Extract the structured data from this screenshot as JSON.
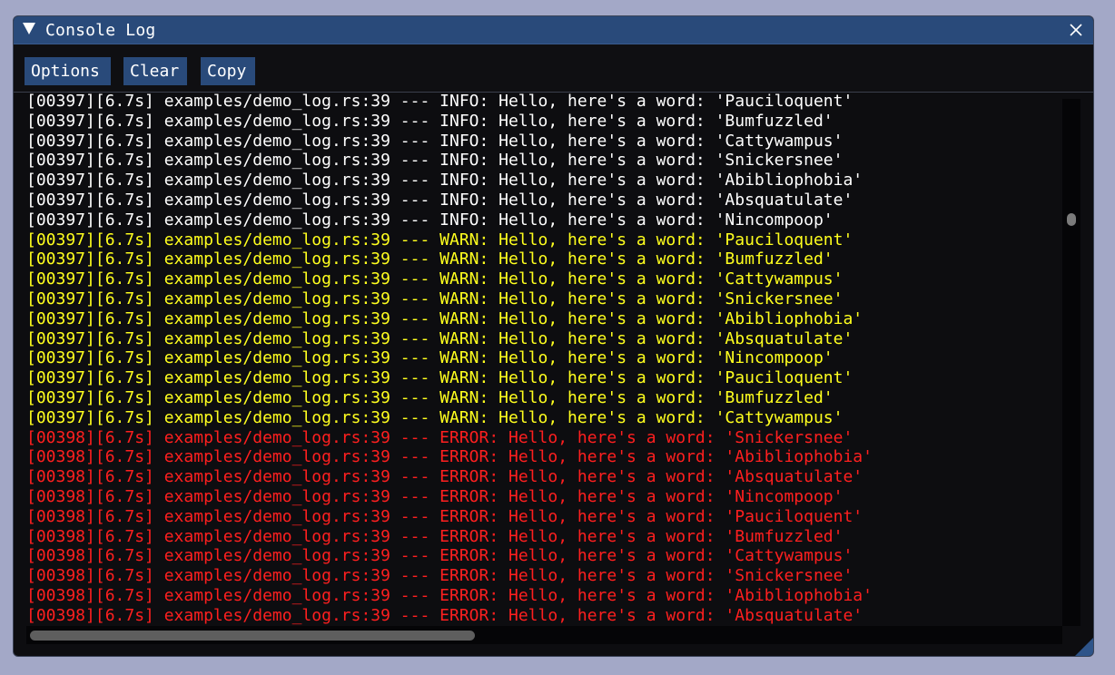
{
  "window": {
    "title": "Console Log",
    "close_glyph": "✕"
  },
  "toolbar": {
    "options_label": "Options",
    "clear_label": "Clear",
    "copy_label": "Copy"
  },
  "colors": {
    "info": "#ffffff",
    "warn": "#ffff1e",
    "error": "#ff1f1f",
    "accent": "#294a7a"
  },
  "icons": {
    "collapse": "collapse-triangle-icon",
    "close": "close-icon"
  },
  "log": [
    {
      "level": "info",
      "text": "[00397][6.7s] examples/demo_log.rs:39 --- INFO: Hello, here's a word: 'Pauciloquent'"
    },
    {
      "level": "info",
      "text": "[00397][6.7s] examples/demo_log.rs:39 --- INFO: Hello, here's a word: 'Bumfuzzled'"
    },
    {
      "level": "info",
      "text": "[00397][6.7s] examples/demo_log.rs:39 --- INFO: Hello, here's a word: 'Cattywampus'"
    },
    {
      "level": "info",
      "text": "[00397][6.7s] examples/demo_log.rs:39 --- INFO: Hello, here's a word: 'Snickersnee'"
    },
    {
      "level": "info",
      "text": "[00397][6.7s] examples/demo_log.rs:39 --- INFO: Hello, here's a word: 'Abibliophobia'"
    },
    {
      "level": "info",
      "text": "[00397][6.7s] examples/demo_log.rs:39 --- INFO: Hello, here's a word: 'Absquatulate'"
    },
    {
      "level": "info",
      "text": "[00397][6.7s] examples/demo_log.rs:39 --- INFO: Hello, here's a word: 'Nincompoop'"
    },
    {
      "level": "warn",
      "text": "[00397][6.7s] examples/demo_log.rs:39 --- WARN: Hello, here's a word: 'Pauciloquent'"
    },
    {
      "level": "warn",
      "text": "[00397][6.7s] examples/demo_log.rs:39 --- WARN: Hello, here's a word: 'Bumfuzzled'"
    },
    {
      "level": "warn",
      "text": "[00397][6.7s] examples/demo_log.rs:39 --- WARN: Hello, here's a word: 'Cattywampus'"
    },
    {
      "level": "warn",
      "text": "[00397][6.7s] examples/demo_log.rs:39 --- WARN: Hello, here's a word: 'Snickersnee'"
    },
    {
      "level": "warn",
      "text": "[00397][6.7s] examples/demo_log.rs:39 --- WARN: Hello, here's a word: 'Abibliophobia'"
    },
    {
      "level": "warn",
      "text": "[00397][6.7s] examples/demo_log.rs:39 --- WARN: Hello, here's a word: 'Absquatulate'"
    },
    {
      "level": "warn",
      "text": "[00397][6.7s] examples/demo_log.rs:39 --- WARN: Hello, here's a word: 'Nincompoop'"
    },
    {
      "level": "warn",
      "text": "[00397][6.7s] examples/demo_log.rs:39 --- WARN: Hello, here's a word: 'Pauciloquent'"
    },
    {
      "level": "warn",
      "text": "[00397][6.7s] examples/demo_log.rs:39 --- WARN: Hello, here's a word: 'Bumfuzzled'"
    },
    {
      "level": "warn",
      "text": "[00397][6.7s] examples/demo_log.rs:39 --- WARN: Hello, here's a word: 'Cattywampus'"
    },
    {
      "level": "error",
      "text": "[00398][6.7s] examples/demo_log.rs:39 --- ERROR: Hello, here's a word: 'Snickersnee'"
    },
    {
      "level": "error",
      "text": "[00398][6.7s] examples/demo_log.rs:39 --- ERROR: Hello, here's a word: 'Abibliophobia'"
    },
    {
      "level": "error",
      "text": "[00398][6.7s] examples/demo_log.rs:39 --- ERROR: Hello, here's a word: 'Absquatulate'"
    },
    {
      "level": "error",
      "text": "[00398][6.7s] examples/demo_log.rs:39 --- ERROR: Hello, here's a word: 'Nincompoop'"
    },
    {
      "level": "error",
      "text": "[00398][6.7s] examples/demo_log.rs:39 --- ERROR: Hello, here's a word: 'Pauciloquent'"
    },
    {
      "level": "error",
      "text": "[00398][6.7s] examples/demo_log.rs:39 --- ERROR: Hello, here's a word: 'Bumfuzzled'"
    },
    {
      "level": "error",
      "text": "[00398][6.7s] examples/demo_log.rs:39 --- ERROR: Hello, here's a word: 'Cattywampus'"
    },
    {
      "level": "error",
      "text": "[00398][6.7s] examples/demo_log.rs:39 --- ERROR: Hello, here's a word: 'Snickersnee'"
    },
    {
      "level": "error",
      "text": "[00398][6.7s] examples/demo_log.rs:39 --- ERROR: Hello, here's a word: 'Abibliophobia'"
    },
    {
      "level": "error",
      "text": "[00398][6.7s] examples/demo_log.rs:39 --- ERROR: Hello, here's a word: 'Absquatulate'"
    }
  ]
}
